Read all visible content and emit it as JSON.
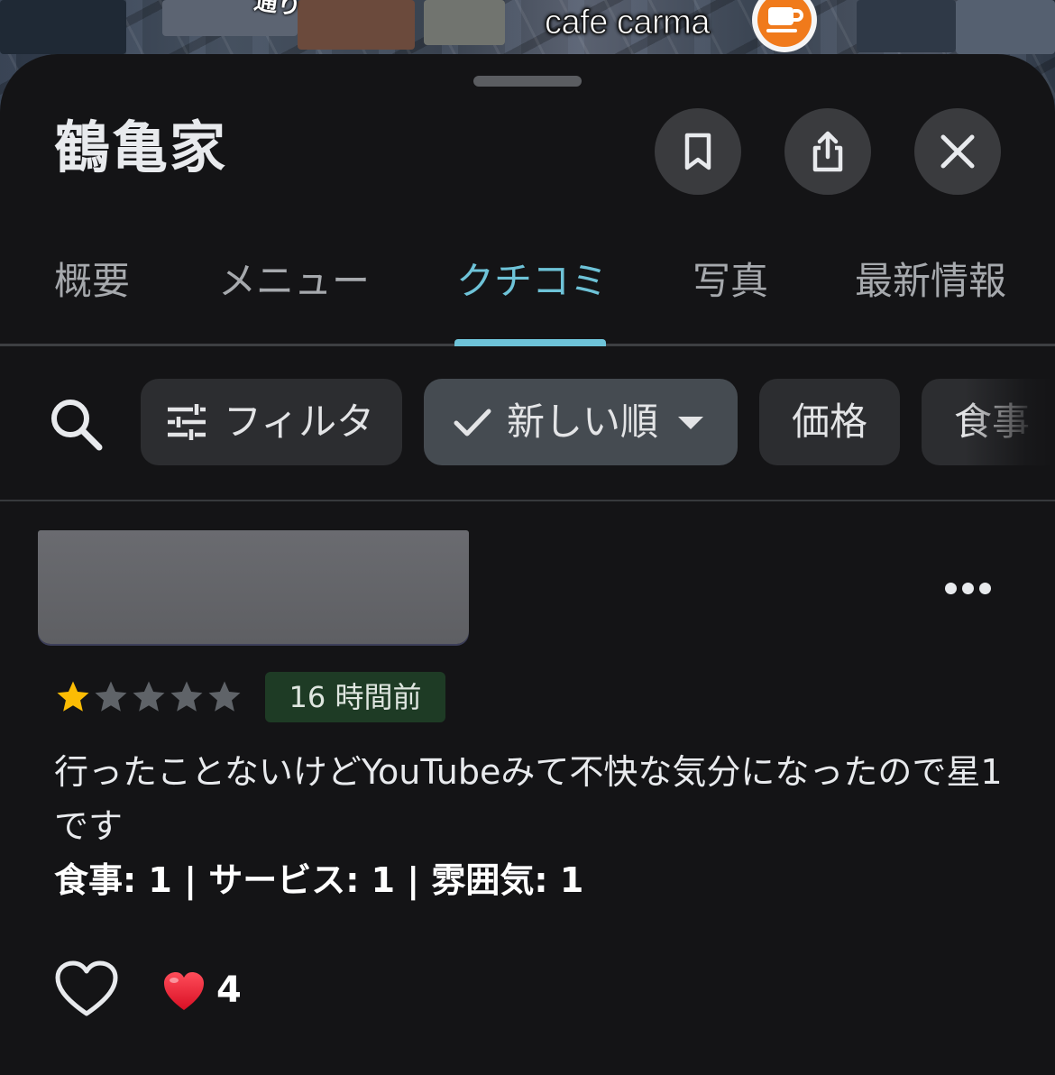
{
  "map": {
    "street_label": "通り",
    "cafe_label": "cafe carma",
    "cafe_pin_icon": "coffee-cup-icon",
    "pin_color": "#f07a1b"
  },
  "place": {
    "title": "鶴亀家"
  },
  "actions": {
    "save_icon": "bookmark-icon",
    "share_icon": "share-icon",
    "close_icon": "close-icon"
  },
  "tabs": [
    {
      "label": "概要",
      "active": false
    },
    {
      "label": "メニュー",
      "active": false
    },
    {
      "label": "クチコミ",
      "active": true
    },
    {
      "label": "写真",
      "active": false
    },
    {
      "label": "最新情報",
      "active": false
    }
  ],
  "filters": {
    "search_icon": "search-icon",
    "filter_label": "フィルタ",
    "sort_label": "新しい順",
    "price_label": "価格",
    "meal_label": "食事"
  },
  "review": {
    "rating": 1,
    "max_rating": 5,
    "time_ago": "16 時間前",
    "text": "行ったことないけどYouTubeみて不快な気分になったので星1です",
    "sub_ratings": "食事: 1 | サービス: 1 | 雰囲気: 1",
    "reaction_emoji": "❤️",
    "reaction_count": "4"
  },
  "colors": {
    "accent": "#6ec3d8",
    "background": "#141416",
    "star_filled": "#fbbc04",
    "star_empty": "#5f6368",
    "time_badge_bg": "#1e3b25"
  }
}
